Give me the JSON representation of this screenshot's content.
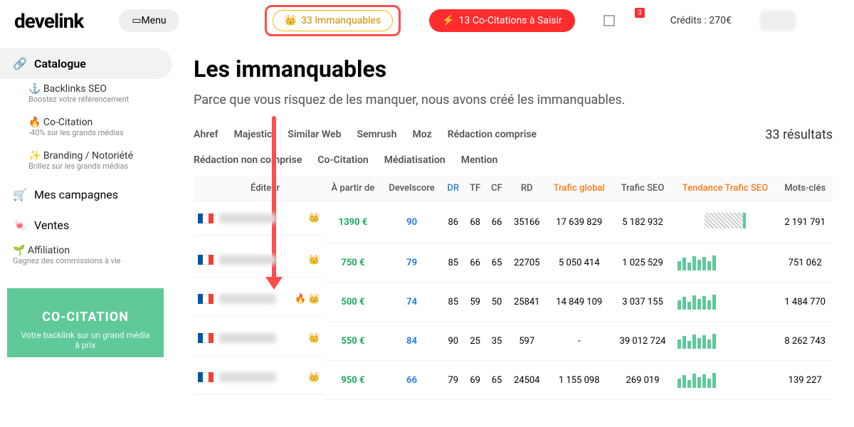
{
  "header": {
    "logo": "develink",
    "menu": "Menu",
    "immanquables_btn": "33 Immanquables",
    "cocitations_btn": "13 Co-Citations à Saisir",
    "bell_count": "3",
    "credits": "Crédits : 270€"
  },
  "sidebar": {
    "catalogue": "Catalogue",
    "backlinks_label": "Backlinks SEO",
    "backlinks_desc": "Boostez votre référencement",
    "cocitation_label": "Co-Citation",
    "cocitation_desc": "-40% sur les grands médias",
    "branding_label": "Branding / Notoriété",
    "branding_desc": "Brillez sur les grands médias",
    "campagnes": "Mes campagnes",
    "ventes": "Ventes",
    "affiliation_label": "Affiliation",
    "affiliation_desc": "Gagnez des commissions à vie",
    "promo_title": "CO-CITATION",
    "promo_text": "Votre backlink sur un grand média à prix"
  },
  "page": {
    "title": "Les immanquables",
    "subtitle": "Parce que vous risquez de les manquer, nous avons créé les immanquables.",
    "results": "33 résultats"
  },
  "filters": [
    "Ahref",
    "Majestic",
    "Similar Web",
    "Semrush",
    "Moz",
    "Rédaction comprise",
    "Rédaction non comprise",
    "Co-Citation",
    "Médiatisation",
    "Mention"
  ],
  "columns": {
    "editor": "Éditeur",
    "from": "À partir de",
    "develscore": "Develscore",
    "dr": "DR",
    "tf": "TF",
    "cf": "CF",
    "rd": "RD",
    "traffic_global": "Trafic global",
    "traffic_seo": "Trafic SEO",
    "trend": "Tendance Trafic SEO",
    "keywords": "Mots-clés"
  },
  "rows": [
    {
      "badges": "👑",
      "price": "1390 €",
      "dr": "90",
      "tf": "86",
      "cf": "68",
      "rd": "66",
      "rd2": "35166",
      "tg": "17 639 829",
      "ts": "5 182 932",
      "kw": "2 191 791",
      "spark": "hatch"
    },
    {
      "badges": "👑",
      "price": "750 €",
      "dr": "79",
      "tf": "85",
      "cf": "66",
      "rd": "65",
      "rd2": "22705",
      "tg": "5 050 414",
      "ts": "1 025 529",
      "kw": "751 062",
      "spark": "bars"
    },
    {
      "badges": "🔥 👑",
      "price": "500 €",
      "dr": "74",
      "tf": "85",
      "cf": "59",
      "rd": "50",
      "rd2": "25841",
      "tg": "14 849 109",
      "ts": "3 037 155",
      "kw": "1 484 770",
      "spark": "bars"
    },
    {
      "badges": "👑",
      "price": "550 €",
      "dr": "84",
      "tf": "90",
      "cf": "25",
      "rd": "35",
      "rd2": "597",
      "tg": "-",
      "ts": "39 012 724",
      "kw": "8 262 743",
      "spark": "bars"
    },
    {
      "badges": "👑",
      "price": "950 €",
      "dr": "66",
      "tf": "79",
      "cf": "69",
      "rd": "65",
      "rd2": "24504",
      "tg": "1 155 098",
      "ts": "269 019",
      "kw": "139 227",
      "spark": "bars"
    }
  ]
}
